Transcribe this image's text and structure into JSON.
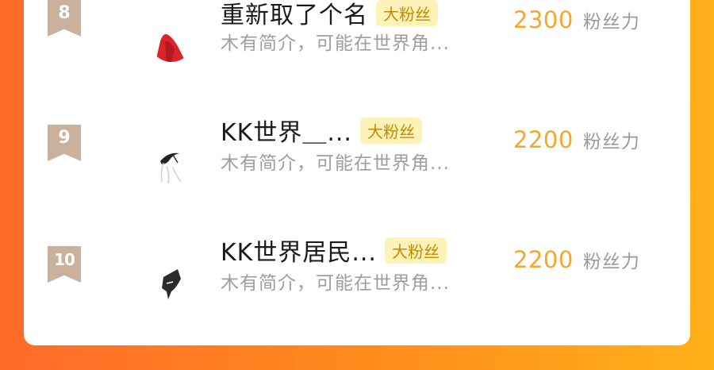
{
  "rows": [
    {
      "rank": "8",
      "name": "重新取了个名",
      "tag": "大粉丝",
      "desc": "木有简介，可能在世界角...",
      "score": "2300",
      "score_unit": "粉丝力"
    },
    {
      "rank": "9",
      "name": "KK世界＿...",
      "tag": "大粉丝",
      "desc": "木有简介，可能在世界角...",
      "score": "2200",
      "score_unit": "粉丝力"
    },
    {
      "rank": "10",
      "name": "KK世界居民...",
      "tag": "大粉丝",
      "desc": "木有简介，可能在世界角...",
      "score": "2200",
      "score_unit": "粉丝力"
    }
  ],
  "colors": {
    "badge": "#c9b19e",
    "tag_bg": "#fdf2b8",
    "tag_text": "#c58a00",
    "score": "#f3a72b"
  }
}
